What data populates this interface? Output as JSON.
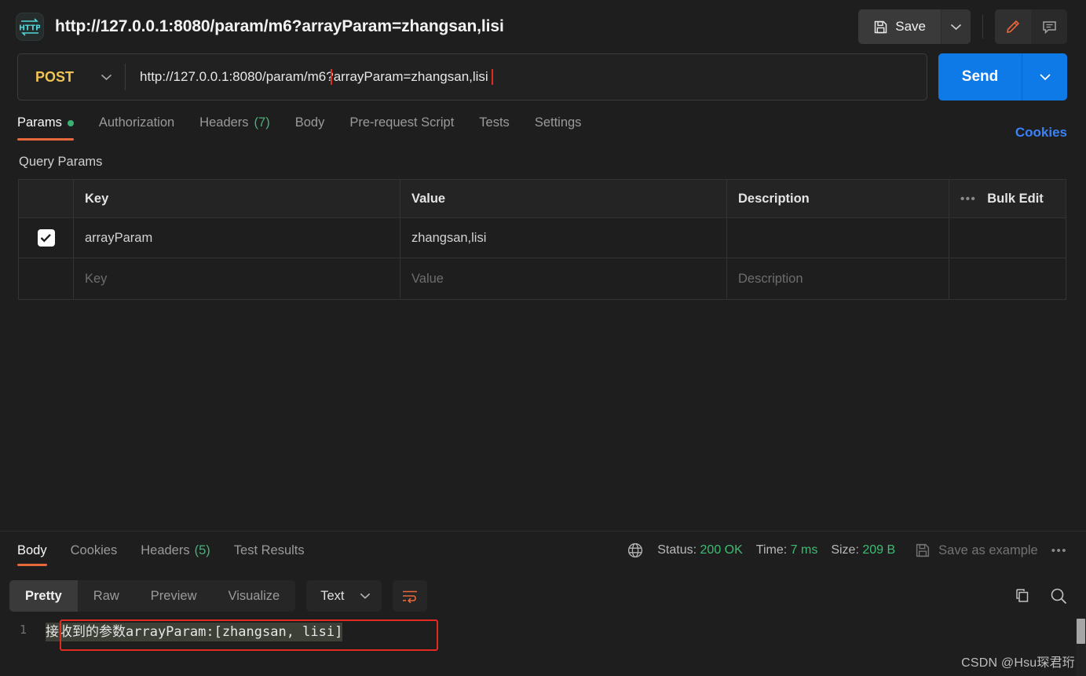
{
  "header": {
    "icon": "http-protocol-icon",
    "request_title": "http://127.0.0.1:8080/param/m6?arrayParam=zhangsan,lisi",
    "save_label": "Save",
    "save_icon": "floppy-disk-icon",
    "save_caret_icon": "chevron-down-icon",
    "edit_icon": "pencil-icon",
    "comment_icon": "comment-icon"
  },
  "url_bar": {
    "method": "POST",
    "method_caret_icon": "chevron-down-icon",
    "url_prefix": "http://127.0.0.1:8080/param/m6?",
    "url_highlighted": "arrayParam=zhangsan,lisi",
    "annotation_color": "#e02b20",
    "send_label": "Send",
    "send_caret_icon": "chevron-down-icon",
    "send_color": "#0d7ae8"
  },
  "request_tabs": {
    "items": [
      {
        "label": "Params",
        "badge": "dot",
        "active": true
      },
      {
        "label": "Authorization",
        "badge": "",
        "active": false
      },
      {
        "label": "Headers",
        "badge": "(7)",
        "active": false
      },
      {
        "label": "Body",
        "badge": "",
        "active": false
      },
      {
        "label": "Pre-request Script",
        "badge": "",
        "active": false
      },
      {
        "label": "Tests",
        "badge": "",
        "active": false
      },
      {
        "label": "Settings",
        "badge": "",
        "active": false
      }
    ],
    "cookies_label": "Cookies",
    "active_underline_color": "#e8683c",
    "badge_color": "#3bb273"
  },
  "query_params": {
    "section_title": "Query Params",
    "columns": [
      "Key",
      "Value",
      "Description"
    ],
    "bulk_edit_label": "Bulk Edit",
    "bulk_more_icon": "more-horizontal-icon",
    "rows": [
      {
        "checked": true,
        "key": "arrayParam",
        "value": "zhangsan,lisi",
        "description": ""
      }
    ],
    "empty_row": {
      "key": "Key",
      "value": "Value",
      "description": "Description"
    }
  },
  "response": {
    "tabs": [
      {
        "label": "Body",
        "badge": "",
        "active": true
      },
      {
        "label": "Cookies",
        "badge": "",
        "active": false
      },
      {
        "label": "Headers",
        "badge": "(5)",
        "active": false
      },
      {
        "label": "Test Results",
        "badge": "",
        "active": false
      }
    ],
    "globe_icon": "globe-icon",
    "status_label": "Status:",
    "status_value": "200 OK",
    "time_label": "Time:",
    "time_value": "7 ms",
    "size_label": "Size:",
    "size_value": "209 B",
    "save_example_label": "Save as example",
    "save_example_icon": "floppy-disk-icon",
    "more_icon": "more-horizontal-icon",
    "status_color": "#3dbd73"
  },
  "viewer": {
    "modes": [
      {
        "label": "Pretty",
        "active": true
      },
      {
        "label": "Raw",
        "active": false
      },
      {
        "label": "Preview",
        "active": false
      },
      {
        "label": "Visualize",
        "active": false
      }
    ],
    "format": "Text",
    "format_caret_icon": "chevron-down-icon",
    "wrap_icon": "word-wrap-icon",
    "copy_icon": "copy-icon",
    "search_icon": "search-icon"
  },
  "body_content": {
    "line_number": "1",
    "text": "接收到的参数arrayParam:[zhangsan, lisi]",
    "annotation_color": "#e02b20"
  },
  "watermark": "CSDN @Hsu琛君珩"
}
